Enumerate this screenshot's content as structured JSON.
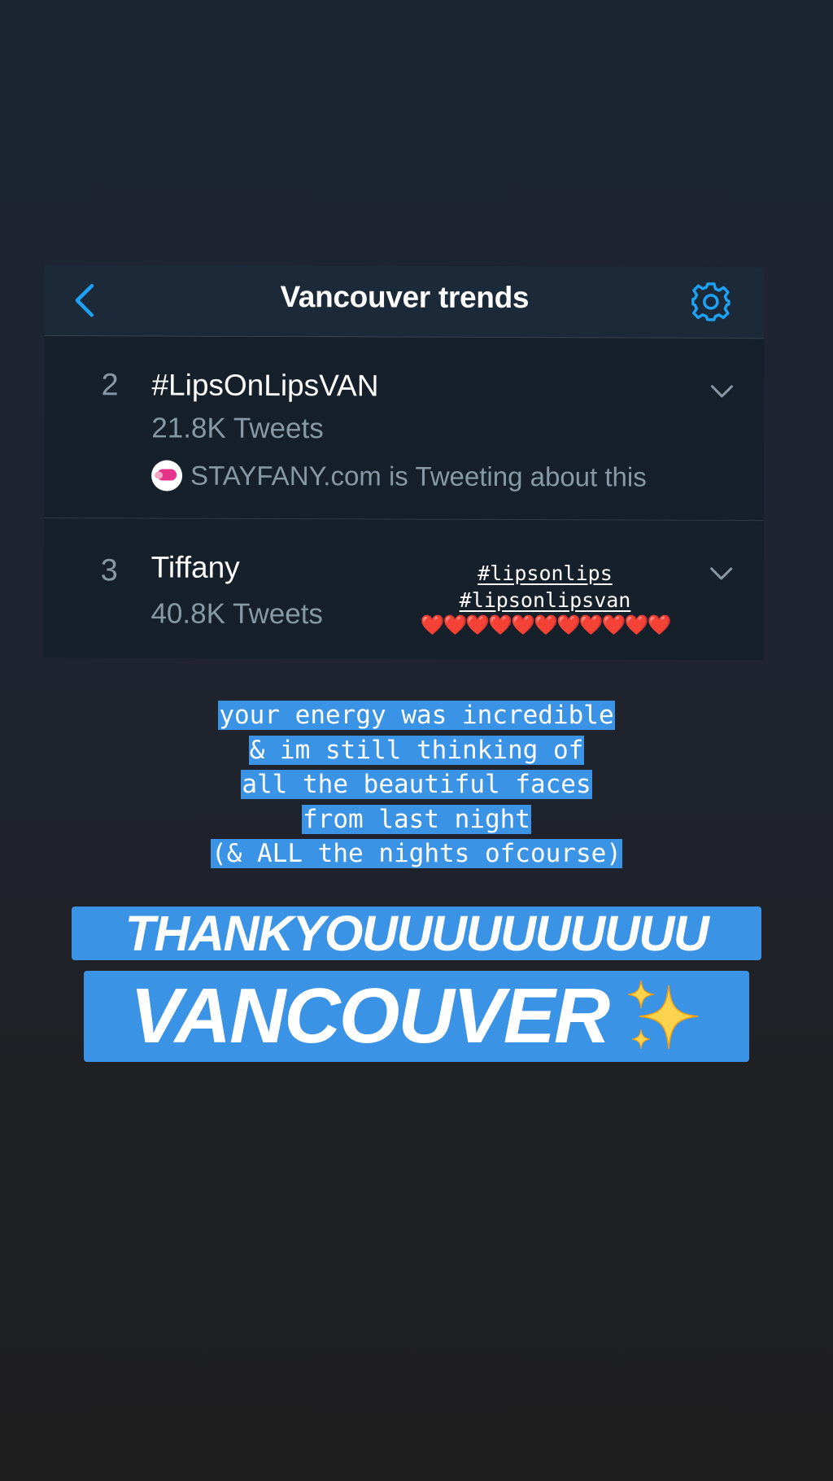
{
  "header": {
    "title": "Vancouver trends",
    "back_icon": "chevron-left-icon",
    "settings_icon": "gear-icon"
  },
  "trends": [
    {
      "rank": "2",
      "name": "#LipsOnLipsVAN",
      "count": "21.8K Tweets",
      "context": "STAYFANY.com is Tweeting about this",
      "context_avatar_text": "StayFany"
    },
    {
      "rank": "3",
      "name": "Tiffany",
      "count": "40.8K Tweets"
    }
  ],
  "sticker": {
    "tags": [
      "#lipsonlips",
      "#lipsonlipsvan"
    ],
    "hearts": "❤️❤️❤️❤️❤️❤️❤️❤️❤️❤️❤️"
  },
  "message": {
    "lines": [
      "your energy was incredible",
      "& im still thinking of",
      "all the beautiful faces",
      "from last night",
      "(& ALL the nights ofcourse)"
    ]
  },
  "banner": {
    "thanks": "THANKYOUUUUUUUUUU",
    "city": "VANCOUVER",
    "emoji": "sparkles"
  },
  "colors": {
    "twitter_blue": "#1da1f2",
    "highlight_blue": "#3b93e5",
    "card_bg": "#15202b",
    "header_bg": "#1c2938",
    "muted_text": "#8899a6",
    "heart_red": "#e0192f",
    "sparkle_yellow": "#fcd34d"
  }
}
